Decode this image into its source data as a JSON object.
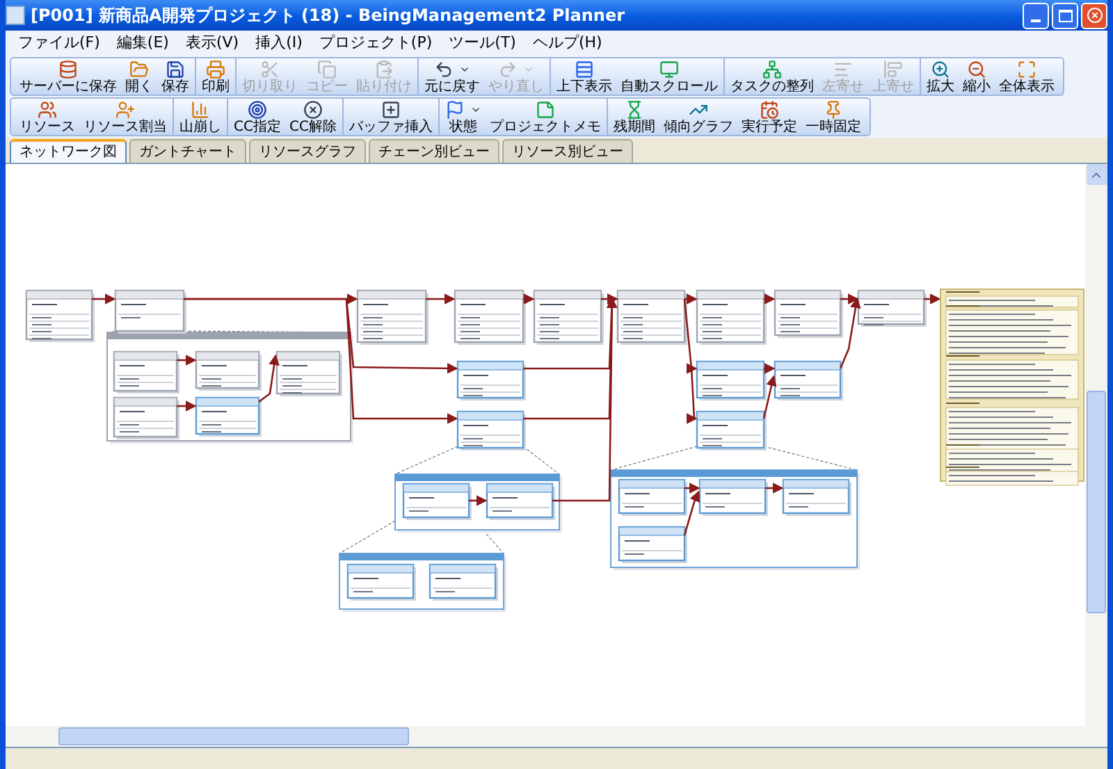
{
  "window": {
    "title": "[P001] 新商品A開発プロジェクト (18) - BeingManagement2 Planner"
  },
  "menu": [
    "ファイル(F)",
    "編集(E)",
    "表示(V)",
    "挿入(I)",
    "プロジェクト(P)",
    "ツール(T)",
    "ヘルプ(H)"
  ],
  "toolbars": [
    [
      [
        {
          "label": "サーバーに保存",
          "disabled": false
        },
        {
          "label": "開く",
          "disabled": false
        },
        {
          "label": "保存",
          "disabled": false
        }
      ],
      [
        {
          "label": "印刷",
          "disabled": false
        }
      ],
      [
        {
          "label": "切り取り",
          "disabled": true
        },
        {
          "label": "コピー",
          "disabled": true
        },
        {
          "label": "貼り付け",
          "disabled": true
        }
      ],
      [
        {
          "label": "元に戻す",
          "disabled": false,
          "has_menu": true
        },
        {
          "label": "やり直し",
          "disabled": true,
          "has_menu": true
        }
      ],
      [
        {
          "label": "上下表示",
          "disabled": false
        },
        {
          "label": "自動スクロール",
          "disabled": false
        }
      ],
      [
        {
          "label": "タスクの整列",
          "disabled": false
        },
        {
          "label": "左寄せ",
          "disabled": true
        },
        {
          "label": "上寄せ",
          "disabled": true
        }
      ],
      [
        {
          "label": "拡大",
          "disabled": false
        },
        {
          "label": "縮小",
          "disabled": false
        },
        {
          "label": "全体表示",
          "disabled": false
        }
      ]
    ],
    [
      [
        {
          "label": "リソース",
          "disabled": false
        },
        {
          "label": "リソース割当",
          "disabled": false
        }
      ],
      [
        {
          "label": "山崩し",
          "disabled": false
        }
      ],
      [
        {
          "label": "CC指定",
          "disabled": false
        },
        {
          "label": "CC解除",
          "disabled": false
        }
      ],
      [
        {
          "label": "バッファ挿入",
          "disabled": false
        }
      ],
      [
        {
          "label": "状態",
          "disabled": false,
          "has_menu": true
        },
        {
          "label": "プロジェクトメモ",
          "disabled": false
        }
      ],
      [
        {
          "label": "残期間",
          "disabled": false
        },
        {
          "label": "傾向グラフ",
          "disabled": false
        },
        {
          "label": "実行予定",
          "disabled": false
        },
        {
          "label": "一時固定",
          "disabled": false
        }
      ]
    ]
  ],
  "tabs": [
    {
      "label": "ネットワーク図",
      "selected": true
    },
    {
      "label": "ガントチャート",
      "selected": false
    },
    {
      "label": "リソースグラフ",
      "selected": false
    },
    {
      "label": "チェーン別ビュー",
      "selected": false
    },
    {
      "label": "リソース別ビュー",
      "selected": false
    }
  ]
}
